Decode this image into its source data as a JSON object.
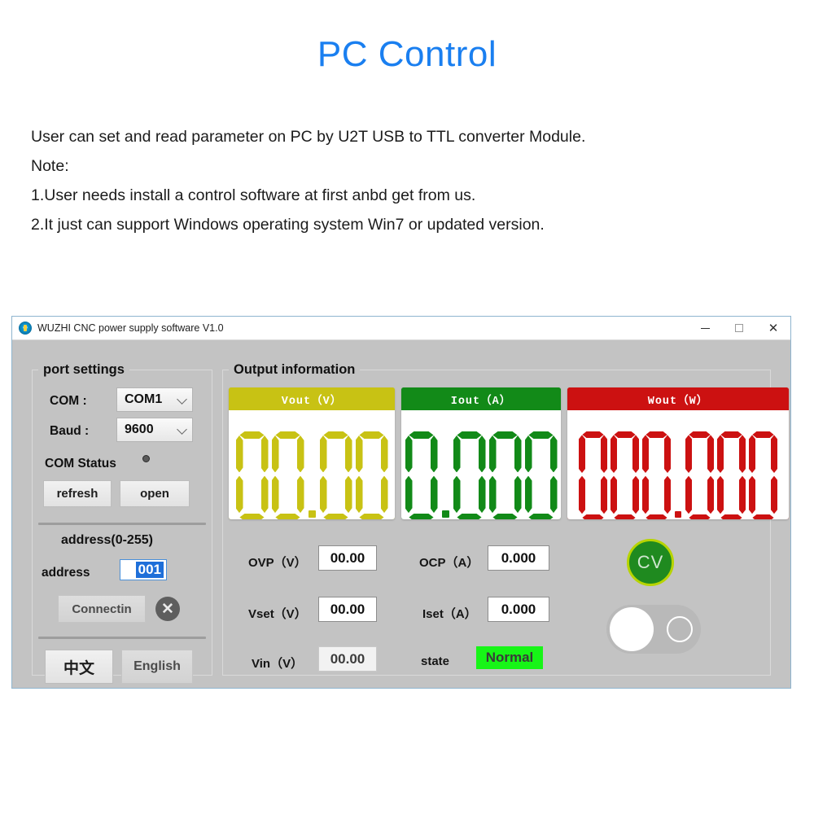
{
  "hero": {
    "title": "PC Control",
    "title_color": "#1a7ff0",
    "lines": [
      "User can set and read parameter on PC by U2T USB to TTL converter Module.",
      "Note:",
      "1.User needs install a control software at first anbd get from us.",
      "2.It just can support Windows operating system Win7 or updated version."
    ]
  },
  "window": {
    "title": "WUZHI CNC power supply software V1.0",
    "icon": "app-logo-icon",
    "minimize": "–",
    "maximize": "□",
    "close": "✕"
  },
  "port_settings": {
    "title": "port settings",
    "com_label": "COM :",
    "com_value": "COM1",
    "baud_label": "Baud  :",
    "baud_value": "9600",
    "com_status_label": "COM Status",
    "refresh_label": "refresh",
    "open_label": "open",
    "address_range_label": "address(0-255)",
    "address_label": "address",
    "address_value": "001",
    "connect_label": "Connectin",
    "clear_icon": "✕",
    "lang_cn_label": "中文",
    "lang_en_label": "English"
  },
  "output": {
    "title": "Output information",
    "meters": [
      {
        "name": "vout",
        "header": "Vout（V）",
        "color": "#c8c214",
        "value": "00.00",
        "digits": [
          "0",
          "0",
          ".",
          "0",
          "0"
        ]
      },
      {
        "name": "iout",
        "header": "Iout（A）",
        "color": "#128a18",
        "value": "0.000",
        "digits": [
          "0",
          ".",
          "0",
          "0",
          "0"
        ]
      },
      {
        "name": "wout",
        "header": "Wout（W）",
        "color": "#cc1111",
        "value": "000.000",
        "digits": [
          "0",
          "0",
          "0",
          ".",
          "0",
          "0",
          "0"
        ]
      }
    ],
    "params": [
      {
        "name": "ovp",
        "label": "OVP（V）",
        "value": "00.00",
        "readonly": false
      },
      {
        "name": "ocp",
        "label": "OCP（A）",
        "value": "0.000",
        "readonly": false
      },
      {
        "name": "vset",
        "label": "Vset（V）",
        "value": "00.00",
        "readonly": false
      },
      {
        "name": "iset",
        "label": "Iset（A）",
        "value": "0.000",
        "readonly": false
      },
      {
        "name": "vin",
        "label": "Vin（V）",
        "value": "00.00",
        "readonly": true
      }
    ],
    "state_label": "state",
    "state_value": "Normal",
    "state_color": "#17f517",
    "mode_badge": "CV",
    "output_toggle_state": "off"
  }
}
